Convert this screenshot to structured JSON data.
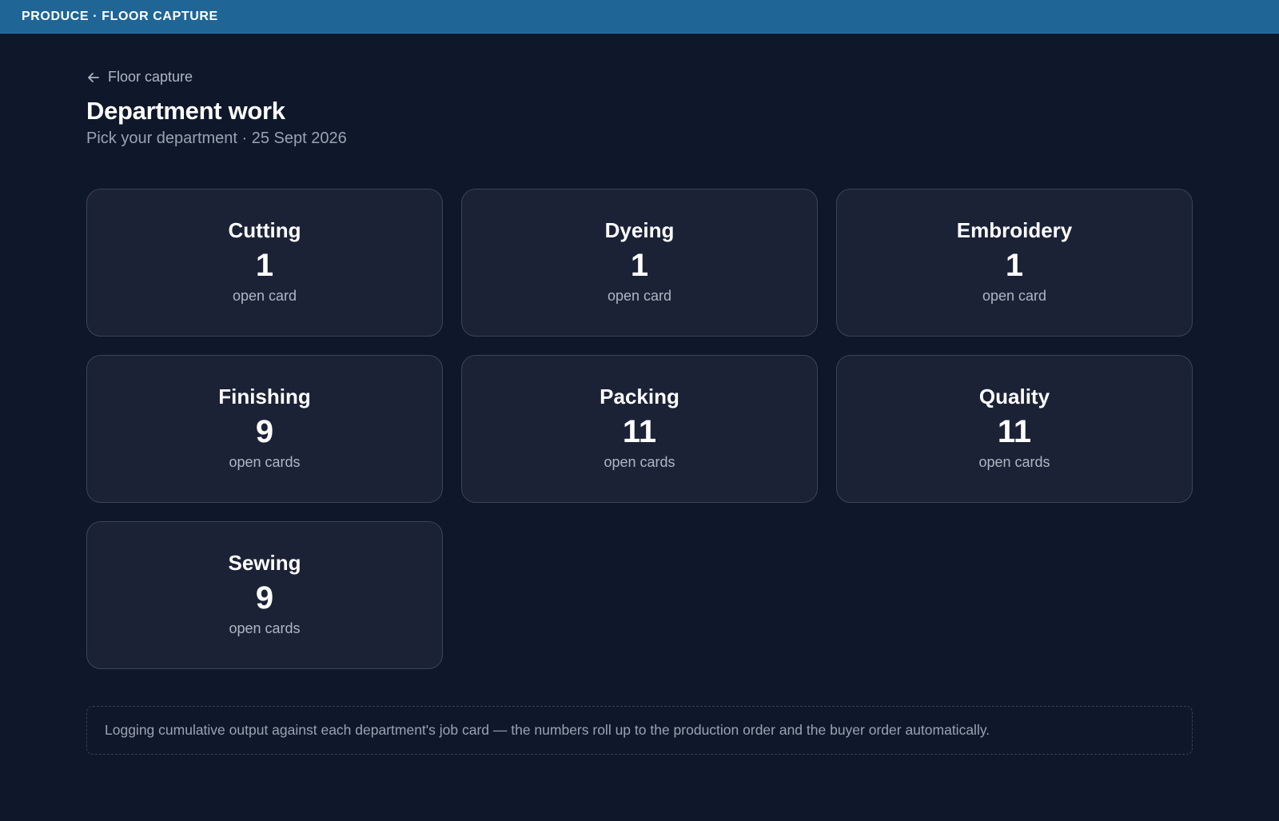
{
  "app": {
    "title": "PRODUCE · FLOOR CAPTURE"
  },
  "header": {
    "back_label": "Floor capture",
    "back_icon": "arrow-left-icon",
    "title": "Department work",
    "subtitle": "Pick your department · 25 Sept 2026"
  },
  "departments": [
    {
      "name": "Cutting",
      "count": "1",
      "unit": "open card"
    },
    {
      "name": "Dyeing",
      "count": "1",
      "unit": "open card"
    },
    {
      "name": "Embroidery",
      "count": "1",
      "unit": "open card"
    },
    {
      "name": "Finishing",
      "count": "9",
      "unit": "open cards"
    },
    {
      "name": "Packing",
      "count": "11",
      "unit": "open cards"
    },
    {
      "name": "Quality",
      "count": "11",
      "unit": "open cards"
    },
    {
      "name": "Sewing",
      "count": "9",
      "unit": "open cards"
    }
  ],
  "note": {
    "text": "Logging cumulative output against each department's job card — the numbers roll up to the production order and the buyer order automatically."
  },
  "colors": {
    "topbar": "#1f6696",
    "background": "#0f172a",
    "card": "#1b2236",
    "card_border": "#3a4458"
  }
}
